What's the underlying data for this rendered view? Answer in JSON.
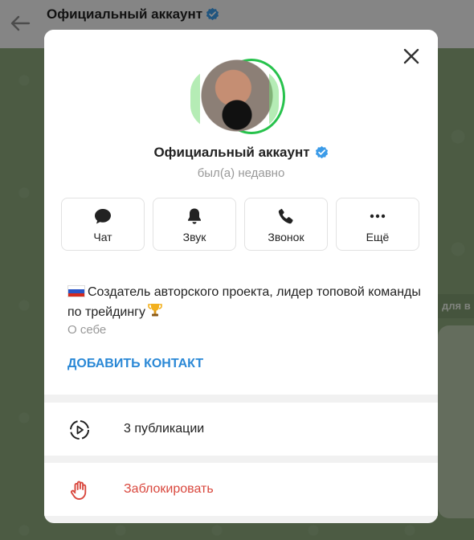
{
  "background": {
    "header_title": "Официальный аккаунт",
    "chip_text": "для в",
    "chat_background_color": "#8aa77a"
  },
  "modal": {
    "name": "Официальный аккаунт",
    "status": "был(а) недавно",
    "actions": [
      {
        "label": "Чат",
        "icon": "chat-bubble-icon"
      },
      {
        "label": "Звук",
        "icon": "bell-icon"
      },
      {
        "label": "Звонок",
        "icon": "phone-icon"
      },
      {
        "label": "Ещё",
        "icon": "more-dots-icon"
      }
    ],
    "about": {
      "flag": "russia-flag",
      "text": "Создатель авторского проекта, лидер топовой команды по трейдингу",
      "emoji": "trophy",
      "label": "О себе",
      "add_contact": "ДОБАВИТЬ КОНТАКТ"
    },
    "publications": {
      "label": "3 публикации",
      "icon": "stories-play-icon"
    },
    "block": {
      "label": "Заблокировать",
      "icon": "hand-stop-icon"
    }
  },
  "colors": {
    "accent": "#2a88d6",
    "verified": "#3b9be8",
    "danger": "#d9473d",
    "online_ring": "#27c24c"
  }
}
